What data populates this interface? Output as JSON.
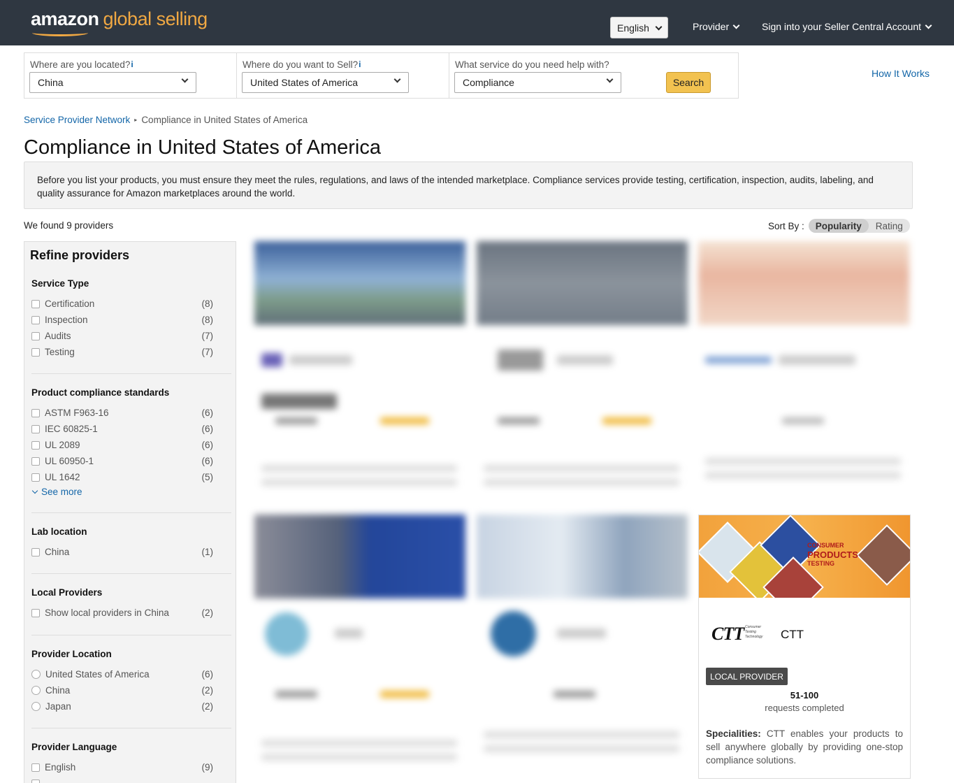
{
  "header": {
    "logo_main": "amazon",
    "logo_sub": "global selling",
    "language": "English",
    "provider_label": "Provider",
    "signin_label": "Sign into your Seller Central Account"
  },
  "search": {
    "located_label": "Where are you located?",
    "located_value": "China",
    "sell_label": "Where do you want to Sell?",
    "sell_value": "United States of America",
    "service_label": "What service do you need help with?",
    "service_value": "Compliance",
    "info_glyph": "i",
    "button": "Search"
  },
  "how_it_works": "How It Works",
  "breadcrumb": {
    "root": "Service Provider Network",
    "current": "Compliance in United States of America"
  },
  "page_title": "Compliance in United States of America",
  "intro": "Before you list your products, you must ensure they meet the rules, regulations, and laws of the intended marketplace. Compliance services provide testing, certification, inspection, audits, labeling, and quality assurance for Amazon marketplaces around the world.",
  "found_text": "We found 9 providers",
  "sort": {
    "label": "Sort By :",
    "options": [
      "Popularity",
      "Rating"
    ],
    "active": "Popularity"
  },
  "sidebar": {
    "title": "Refine providers",
    "service_type": {
      "title": "Service Type",
      "options": [
        {
          "label": "Certification",
          "count": "(8)"
        },
        {
          "label": "Inspection",
          "count": "(8)"
        },
        {
          "label": "Audits",
          "count": "(7)"
        },
        {
          "label": "Testing",
          "count": "(7)"
        }
      ]
    },
    "standards": {
      "title": "Product compliance standards",
      "options": [
        {
          "label": "ASTM F963-16",
          "count": "(6)"
        },
        {
          "label": "IEC 60825-1",
          "count": "(6)"
        },
        {
          "label": "UL 2089",
          "count": "(6)"
        },
        {
          "label": "UL 60950-1",
          "count": "(6)"
        },
        {
          "label": "UL 1642",
          "count": "(5)"
        }
      ],
      "see_more": "See more"
    },
    "lab_location": {
      "title": "Lab location",
      "options": [
        {
          "label": "China",
          "count": "(1)"
        }
      ]
    },
    "local_providers": {
      "title": "Local Providers",
      "options": [
        {
          "label": "Show local providers in China",
          "count": "(2)"
        }
      ]
    },
    "provider_location": {
      "title": "Provider Location",
      "options": [
        {
          "label": "United States of America",
          "count": "(6)"
        },
        {
          "label": "China",
          "count": "(2)"
        },
        {
          "label": "Japan",
          "count": "(2)"
        }
      ]
    },
    "provider_language": {
      "title": "Provider Language",
      "options": [
        {
          "label": "English",
          "count": "(9)"
        }
      ]
    }
  },
  "ctt_card": {
    "banner_line1": "CONSUMER",
    "banner_line2": "PRODUCTS",
    "banner_line3": "TESTING",
    "logo": "CTT",
    "logo_sub": "Consumer Testing Technology",
    "name": "CTT",
    "badge": "LOCAL PROVIDER",
    "requests_range": "51-100",
    "requests_label": "requests completed",
    "spec_label": "Specialities:",
    "spec_text": "CTT enables your products to sell anywhere globally by providing one-stop compliance solutions."
  },
  "colors": {
    "header_bg": "#2f3741",
    "logo_accent": "#f0a843",
    "link": "#1366a8",
    "search_button": "#f2c250",
    "badge_bg": "#4a4a4a"
  }
}
